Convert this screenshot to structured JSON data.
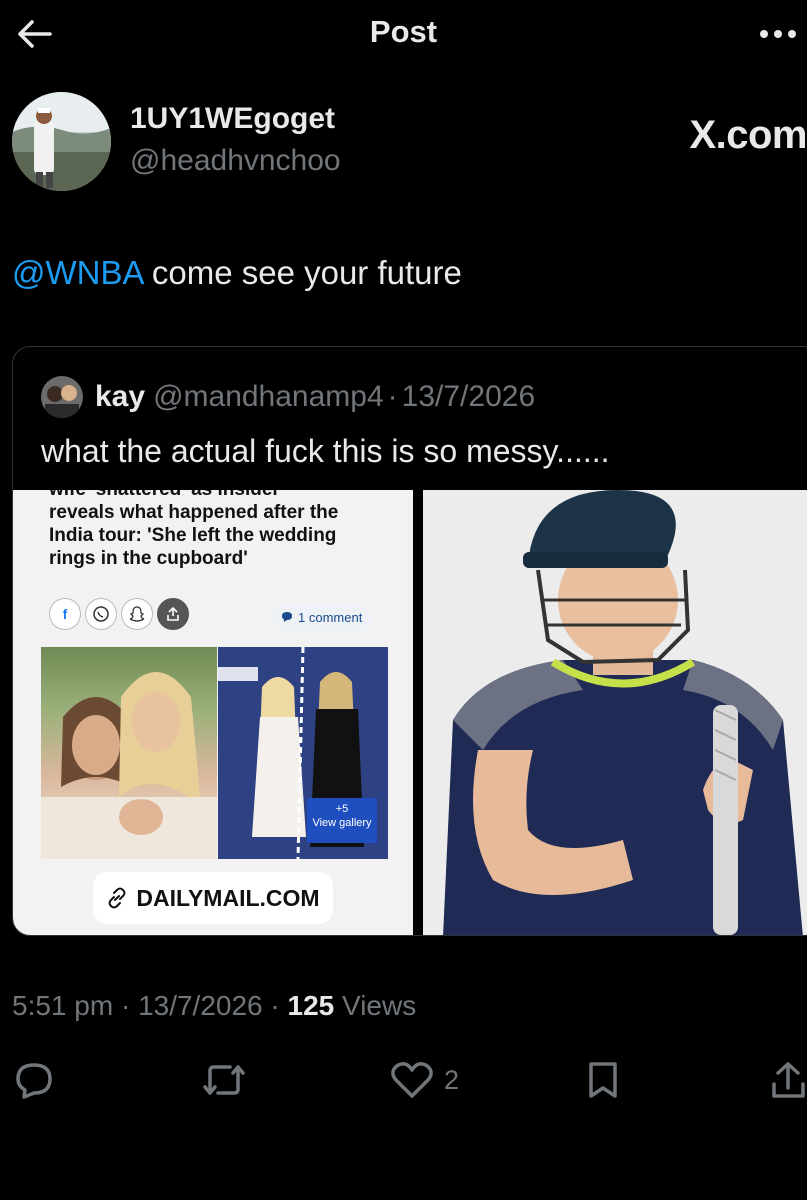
{
  "header": {
    "title": "Post"
  },
  "author": {
    "name": "1UY1WEgoget",
    "handle": "@headhvnchoo"
  },
  "watermark": "X.com",
  "tweet": {
    "mention": "@WNBA",
    "text": " come see your future"
  },
  "quote": {
    "name": "kay",
    "handle": "@mandhanamp4",
    "sep": "·",
    "date": "13/7/2026",
    "text": "what the actual fuck this is so messy......",
    "article": {
      "line1": "wife 'shattered' as insider",
      "line2": "reveals what happened after the",
      "line3": "India tour: 'She left the wedding",
      "line4": "rings in the cupboard'",
      "comments": "1 comment",
      "gallery_count": "+5",
      "gallery_label": "View gallery",
      "source": "DAILYMAIL.COM"
    }
  },
  "meta": {
    "time": "5:51 pm",
    "sep1": " · ",
    "date": "13/7/2026",
    "sep2": " · ",
    "views": "125",
    "views_label": " Views"
  },
  "actions": {
    "likes": "2"
  },
  "colors": {
    "accent": "#1d9bf0",
    "muted": "#71767b",
    "text": "#e7e9ea",
    "bg": "#000000"
  }
}
